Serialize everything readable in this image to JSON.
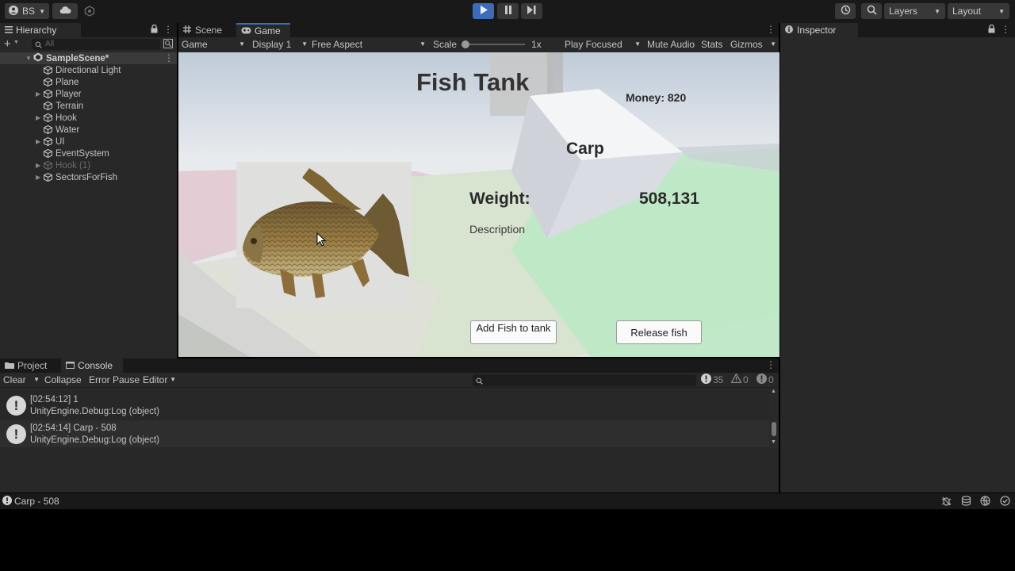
{
  "toolbar": {
    "account_label": "BS",
    "layers_label": "Layers",
    "layout_label": "Layout"
  },
  "hierarchy": {
    "tab_label": "Hierarchy",
    "search_placeholder": "All",
    "scene_name": "SampleScene*",
    "items": [
      {
        "label": "Directional Light"
      },
      {
        "label": "Plane"
      },
      {
        "label": "Player"
      },
      {
        "label": "Terrain"
      },
      {
        "label": "Hook"
      },
      {
        "label": "Water"
      },
      {
        "label": "UI"
      },
      {
        "label": "EventSystem"
      },
      {
        "label": "Hook (1)"
      },
      {
        "label": "SectorsForFish"
      }
    ]
  },
  "center_tabs": [
    {
      "label": "Scene"
    },
    {
      "label": "Game"
    }
  ],
  "game_toolbar": {
    "view_select": "Game",
    "display_select": "Display 1",
    "aspect_select": "Free Aspect",
    "scale_label": "Scale",
    "scale_value": "1x",
    "play_focused": "Play Focused",
    "mute_audio": "Mute Audio",
    "stats": "Stats",
    "gizmos": "Gizmos"
  },
  "game": {
    "title": "Fish Tank",
    "money": "Money: 820",
    "fish_name": "Carp",
    "weight_label": "Weight:",
    "weight_value": "508,131",
    "description": "Description",
    "add_button": "Add Fish to tank",
    "release_button": "Release fish"
  },
  "inspector": {
    "tab_label": "Inspector"
  },
  "bottom_tabs": [
    {
      "label": "Project"
    },
    {
      "label": "Console"
    }
  ],
  "console_toolbar": {
    "clear": "Clear",
    "collapse": "Collapse",
    "error_pause": "Error Pause",
    "editor": "Editor",
    "log_count": "35",
    "warn_count": "0",
    "error_count": "0"
  },
  "console": {
    "entries": [
      {
        "line1": "[02:54:12] 1",
        "line2": "UnityEngine.Debug:Log (object)"
      },
      {
        "line1": "[02:54:14] Carp - 508",
        "line2": "UnityEngine.Debug:Log (object)"
      }
    ]
  },
  "status": {
    "message": "Carp - 508"
  },
  "colors": {
    "accent": "#3d6bb8",
    "panel_bg": "#282828",
    "toolbar_bg": "#191919"
  }
}
